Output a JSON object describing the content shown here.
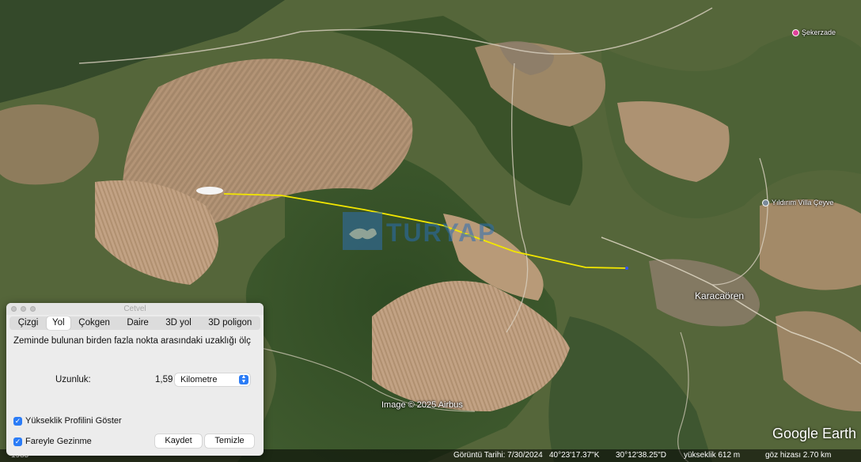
{
  "map": {
    "places": {
      "town": "Karacaören",
      "poi_villa": "Yıldırım Villa Çeyve",
      "poi_shop": "Şekerzade"
    },
    "watermark": "Image © 2025 Airbus",
    "logo": "Google Earth",
    "overlay_watermark": "TURYAP",
    "path_color": "#f2e600"
  },
  "statusbar": {
    "left": "1985",
    "date": "Görüntü Tarihi: 7/30/2024",
    "lat": "40°23'17.37\"K",
    "lon": "30°12'38.25\"D",
    "elevation": "yükseklik   612 m",
    "eye": "göz hizası   2.70 km"
  },
  "ruler": {
    "title": "Cetvel",
    "tabs": [
      "Çizgi",
      "Yol",
      "Çokgen",
      "Daire",
      "3D yol",
      "3D poligon"
    ],
    "active_tab": "Yol",
    "description": "Zeminde bulunan birden fazla nokta arasındaki uzaklığı ölç",
    "length_label": "Uzunluk:",
    "length_value": "1,59",
    "unit": "Kilometre",
    "show_profile_label": "Yükseklik Profilini Göster",
    "show_profile_checked": true,
    "mouse_nav_label": "Fareyle Gezinme",
    "mouse_nav_checked": true,
    "save_label": "Kaydet",
    "clear_label": "Temizle"
  }
}
